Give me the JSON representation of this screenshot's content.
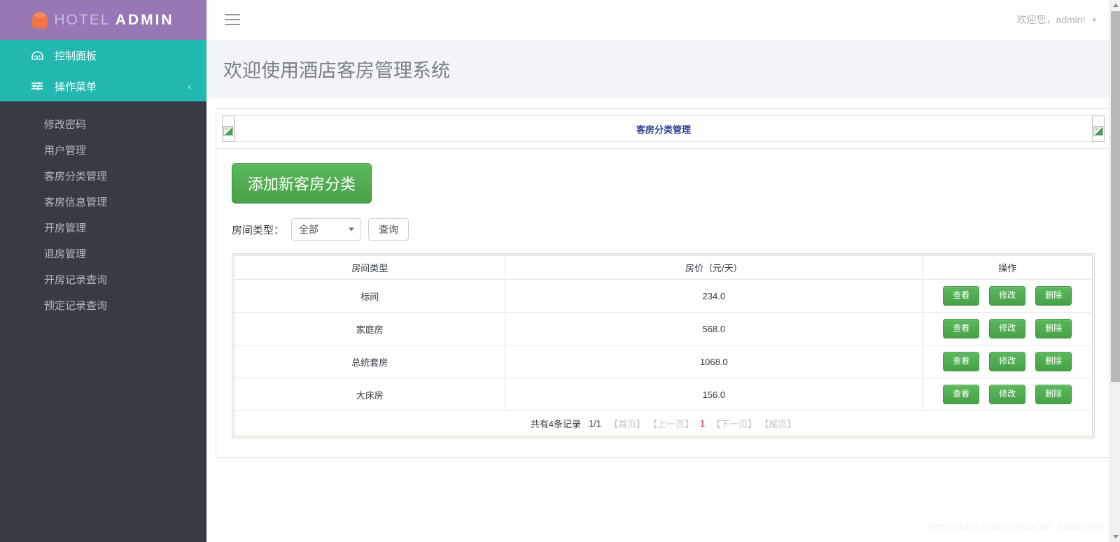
{
  "brand": {
    "logo_icon": "paint-bucket-icon",
    "name_first": "HOTEL",
    "name_second": "ADMIN"
  },
  "sidebar": {
    "primary": [
      {
        "label": "控制面板",
        "icon": "dashboard-icon",
        "active": true
      },
      {
        "label": "操作菜单",
        "icon": "sliders-icon",
        "active": true,
        "collapse_icon": "chevron-left-icon"
      }
    ],
    "items": [
      {
        "label": "修改密码"
      },
      {
        "label": "用户管理"
      },
      {
        "label": "客房分类管理"
      },
      {
        "label": "客房信息管理"
      },
      {
        "label": "开房管理"
      },
      {
        "label": "退房管理"
      },
      {
        "label": "开房记录查询"
      },
      {
        "label": "预定记录查询"
      }
    ]
  },
  "topbar": {
    "menu_icon": "hamburger-icon",
    "welcome_text": "欢迎您，admin!",
    "caret_icon": "chevron-down-icon"
  },
  "page": {
    "title": "欢迎使用酒店客房管理系统"
  },
  "panel": {
    "title": "客房分类管理",
    "left_image": "broken-image-icon",
    "right_image": "broken-image-icon"
  },
  "toolbar": {
    "add_label": "添加新客房分类",
    "filter_label": "房间类型：",
    "select_value": "全部",
    "select_options": [
      "全部"
    ],
    "query_label": "查询"
  },
  "table": {
    "headers": [
      "房间类型",
      "房价（元/天）",
      "操作"
    ],
    "rows": [
      {
        "type": "标间",
        "price": "234.0"
      },
      {
        "type": "家庭房",
        "price": "568.0"
      },
      {
        "type": "总统套房",
        "price": "1068.0"
      },
      {
        "type": "大床房",
        "price": "156.0"
      }
    ],
    "actions": {
      "view": "查看",
      "edit": "修改",
      "delete": "删除"
    }
  },
  "pagination": {
    "summary": "共有4条记录",
    "page_info": "1/1",
    "first": "【首页】",
    "prev": "【上一页】",
    "current": "1",
    "next": "【下一页】",
    "last": "【尾页】"
  },
  "watermark": "https://blog.csdn.net/weixin_44505789",
  "colors": {
    "brand_bg": "#9777b5",
    "nav_active": "#22b8b0",
    "sidebar_bg": "#373b44",
    "button_green": "#4cae4c",
    "panel_title": "#2c3e8f",
    "current_page": "#e01b1b",
    "table_bg": "#edf8e2"
  }
}
